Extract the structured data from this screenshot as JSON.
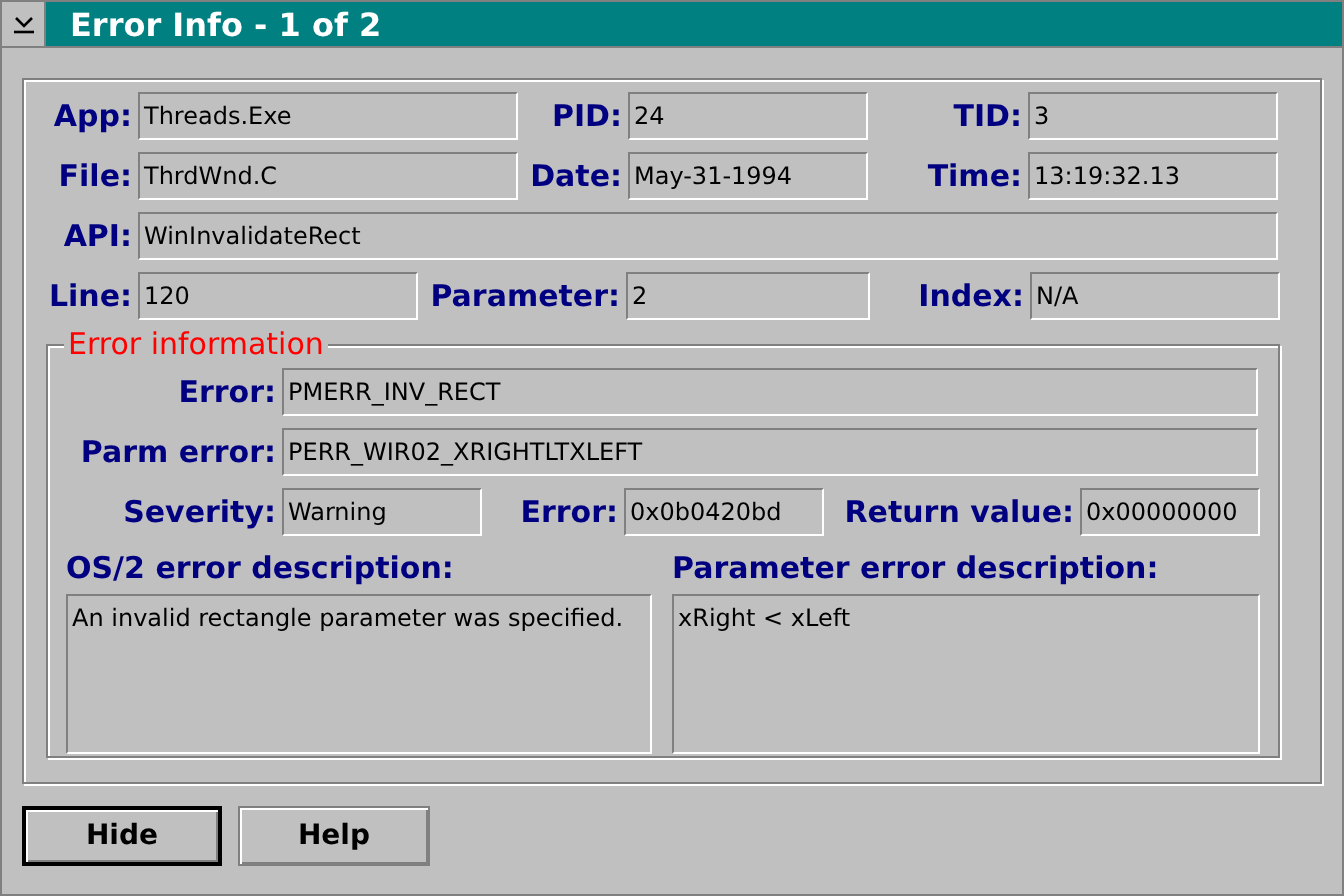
{
  "window": {
    "title": "Error Info - 1 of 2"
  },
  "info_rows": [
    [
      {
        "label": "App:",
        "value": "Threads.Exe"
      },
      {
        "label": "PID:",
        "value": "24"
      },
      {
        "label": "TID:",
        "value": "3"
      }
    ],
    [
      {
        "label": "File:",
        "value": "ThrdWnd.C"
      },
      {
        "label": "Date:",
        "value": "May-31-1994"
      },
      {
        "label": "Time:",
        "value": "13:19:32.13"
      }
    ],
    [
      {
        "label": "API:",
        "value": "WinInvalidateRect"
      }
    ],
    [
      {
        "label": "Line:",
        "value": "120"
      },
      {
        "label": "Parameter:",
        "value": "2"
      },
      {
        "label": "Index:",
        "value": "N/A"
      }
    ]
  ],
  "error_group": {
    "title": "Error information",
    "rows": [
      [
        {
          "label": "Error:",
          "value": "PMERR_INV_RECT"
        }
      ],
      [
        {
          "label": "Parm error:",
          "value": "PERR_WIR02_XRIGHTLTXLEFT"
        }
      ],
      [
        {
          "label": "Severity:",
          "value": "Warning"
        },
        {
          "label": "Error:",
          "value": "0x0b0420bd"
        },
        {
          "label": "Return value:",
          "value": "0x00000000"
        }
      ]
    ],
    "descriptions": [
      {
        "label": "OS/2 error description:",
        "text": "An invalid rectangle parameter was specified."
      },
      {
        "label": "Parameter error description:",
        "text": "xRight < xLeft"
      }
    ]
  },
  "buttons": [
    {
      "label": "Hide",
      "default": true
    },
    {
      "label": "Help",
      "default": false
    }
  ]
}
